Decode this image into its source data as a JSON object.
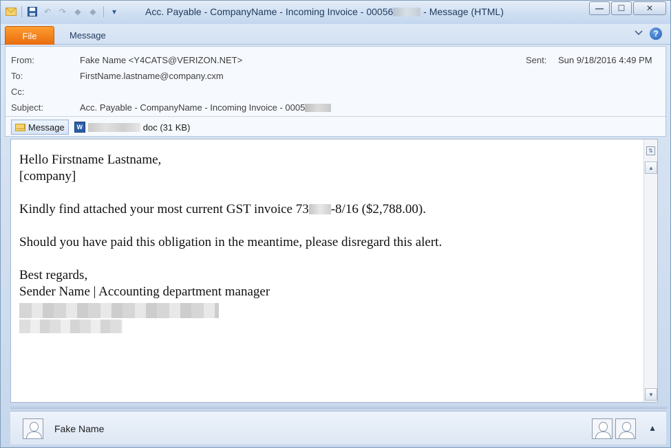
{
  "window": {
    "title_prefix": "Acc. Payable - CompanyName - Incoming Invoice - 00056",
    "title_suffix": "-  Message (HTML)",
    "quick_access": [
      "mail-icon",
      "save-icon",
      "undo-icon",
      "redo-icon",
      "previous-icon",
      "next-icon",
      "customize-icon"
    ],
    "minimize": "—",
    "maximize": "☐",
    "close": "✕"
  },
  "ribbon": {
    "file_tab": "File",
    "message_tab": "Message",
    "collapse": "♡",
    "help": "?"
  },
  "header": {
    "from_label": "From:",
    "from_value": "Fake Name <Y4CATS@VERIZON.NET>",
    "to_label": "To:",
    "to_value": "FirstName.lastname@company.cxm",
    "cc_label": "Cc:",
    "cc_value": "",
    "subject_label": "Subject:",
    "subject_value": "Acc. Payable - CompanyName - Incoming Invoice - 0005",
    "sent_label": "Sent:",
    "sent_value": "Sun 9/18/2016 4:49 PM"
  },
  "attachments": {
    "message_label": "Message",
    "doc_suffix": "doc (31 KB)"
  },
  "body": {
    "greeting": "Hello Firstname Lastname,",
    "company": "[company]",
    "line1_prefix": "Kindly find attached your most current GST invoice 73",
    "line1_suffix": "-8/16 ($2,788.00).",
    "line2": "Should you have paid this obligation in the meantime, please disregard this alert.",
    "closing": "Best regards,",
    "signature": "Sender Name | Accounting department manager"
  },
  "people_pane": {
    "name": "Fake Name",
    "expand": "▲"
  },
  "colors": {
    "file_tab": "#f07d1a",
    "title_text": "#1e395b",
    "frame": "#c7d7ec"
  }
}
